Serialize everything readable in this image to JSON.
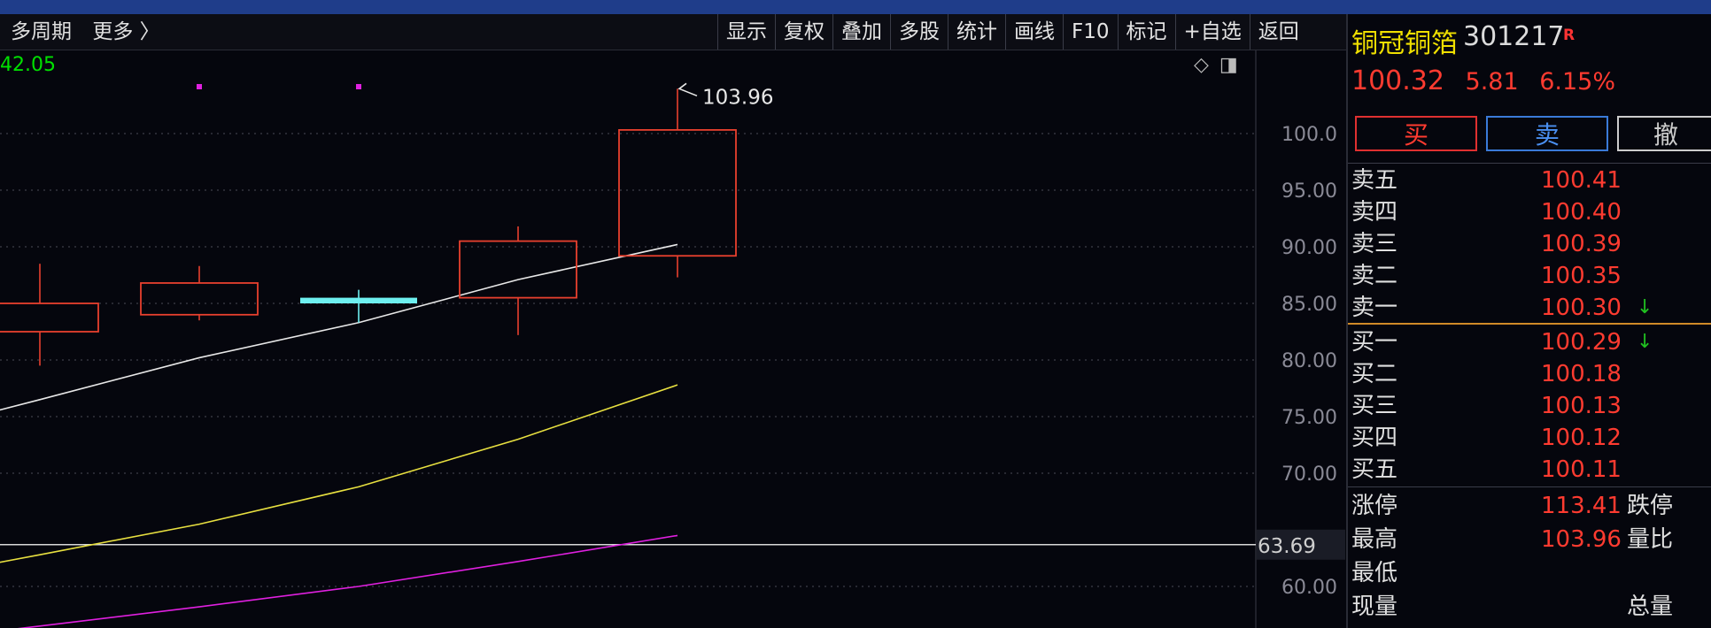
{
  "toolbar": {
    "left_items": [
      "多周期",
      "更多 〉"
    ],
    "buttons": [
      "显示",
      "复权",
      "叠加",
      "多股",
      "统计",
      "画线",
      "F10",
      "标记",
      "+自选",
      "返回"
    ]
  },
  "chart": {
    "ohlc_label": "42.05",
    "high_marker_label": "103.96",
    "current_line_label": "63.69",
    "y_ticks": [
      "100.0",
      "95.00",
      "90.00",
      "85.00",
      "80.00",
      "75.00",
      "70.00",
      "60.00"
    ],
    "icons": [
      "diamond-icon",
      "panel-toggle-icon"
    ],
    "colors": {
      "up_candle": "#e8402e",
      "doji": "#6ef0f0",
      "ma_white": "#e8e8e8",
      "ma_yellow": "#e8e040",
      "ma_magenta": "#e020e0",
      "marker": "#e020e0",
      "ref_line": "#d8d8d8"
    }
  },
  "chart_data": {
    "type": "candlestick",
    "y_ticks": [
      100.0,
      95.0,
      90.0,
      85.0,
      80.0,
      75.0,
      70.0,
      60.0
    ],
    "reference_line": 63.69,
    "candles": [
      {
        "open": 82.5,
        "close": 85.0,
        "high": 88.5,
        "low": 79.5,
        "color": "up"
      },
      {
        "open": 84.0,
        "close": 86.8,
        "high": 88.3,
        "low": 83.5,
        "color": "up"
      },
      {
        "open": 85.0,
        "close": 85.5,
        "high": 86.2,
        "low": 83.3,
        "color": "doji"
      },
      {
        "open": 85.5,
        "close": 90.5,
        "high": 91.8,
        "low": 82.2,
        "color": "up"
      },
      {
        "open": 89.2,
        "close": 100.32,
        "high": 103.96,
        "low": 87.3,
        "color": "up"
      }
    ],
    "ma_white": [
      76.5,
      80.2,
      83.3,
      87.1,
      90.2
    ],
    "ma_yellow": [
      62.8,
      65.5,
      68.8,
      73.0,
      77.8
    ],
    "ma_magenta": [
      56.5,
      58.2,
      60.0,
      62.2,
      64.5
    ]
  },
  "stock": {
    "name": "铜冠铜箔",
    "code": "301217",
    "badge": "R",
    "price": "100.32",
    "change": "5.81",
    "change_pct": "6.15%"
  },
  "trade": {
    "buy": "买",
    "sell": "卖",
    "cancel": "撤"
  },
  "order_book": {
    "asks": [
      {
        "label": "卖五",
        "price": "100.41"
      },
      {
        "label": "卖四",
        "price": "100.40"
      },
      {
        "label": "卖三",
        "price": "100.39"
      },
      {
        "label": "卖二",
        "price": "100.35"
      },
      {
        "label": "卖一",
        "price": "100.30",
        "arrow": "down"
      }
    ],
    "bids": [
      {
        "label": "买一",
        "price": "100.29",
        "arrow": "down"
      },
      {
        "label": "买二",
        "price": "100.18"
      },
      {
        "label": "买三",
        "price": "100.13"
      },
      {
        "label": "买四",
        "price": "100.12"
      },
      {
        "label": "买五",
        "price": "100.11"
      }
    ]
  },
  "stats": [
    {
      "label": "涨停",
      "value": "113.41",
      "label2": "跌停"
    },
    {
      "label": "最高",
      "value": "103.96",
      "label2": "量比"
    },
    {
      "label": "最低",
      "value": "",
      "label2": ""
    },
    {
      "label": "现量",
      "value": "",
      "label2": "总量"
    }
  ]
}
